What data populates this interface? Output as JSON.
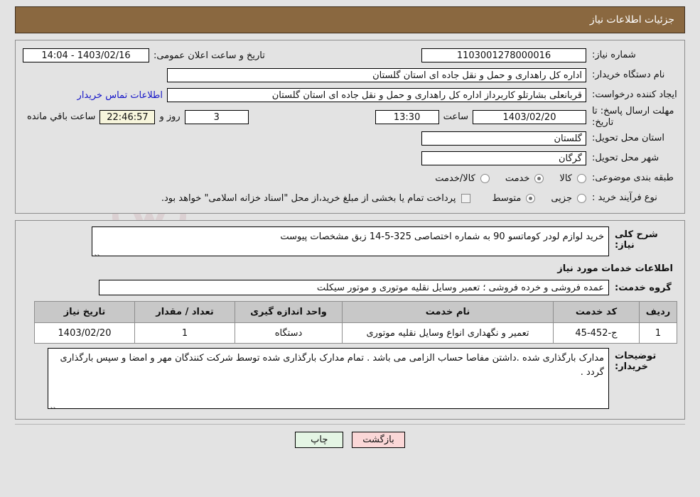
{
  "header": {
    "title": "جزئیات اطلاعات نیاز"
  },
  "watermark": {
    "text": "AriaTender.net",
    "shield_icon": "shield-icon"
  },
  "info": {
    "need_number_label": "شماره نیاز:",
    "need_number_value": "1103001278000016",
    "public_announce_label": "تاریخ و ساعت اعلان عمومی:",
    "public_announce_value": "1403/02/16 - 14:04",
    "buyer_org_label": "نام دستگاه خریدار:",
    "buyer_org_value": "اداره کل راهداری و حمل و نقل جاده ای استان گلستان",
    "creator_label": "ایجاد کننده درخواست:",
    "creator_value": "قربانعلی بشارتلو کاربرداز اداره کل راهداری و حمل و نقل جاده ای استان گلستان",
    "contact_link": "اطلاعات تماس خریدار",
    "deadline_label": "مهلت ارسال پاسخ: تا تاریخ:",
    "deadline_date": "1403/02/20",
    "deadline_hour_label": "ساعت",
    "deadline_time": "13:30",
    "remaining_days": "3",
    "remaining_days_label": "روز و",
    "remaining_clock": "22:46:57",
    "remaining_suffix_label": "ساعت باقي مانده",
    "province_label": "استان محل تحویل:",
    "province_value": "گلستان",
    "city_label": "شهر محل تحویل:",
    "city_value": "گرگان",
    "category_label": "طبقه بندی موضوعی:",
    "category_options": [
      {
        "label": "کالا",
        "selected": false
      },
      {
        "label": "خدمت",
        "selected": true
      },
      {
        "label": "کالا/خدمت",
        "selected": false
      }
    ],
    "process_label": "نوع فرآیند خرید :",
    "process_options": [
      {
        "label": "جزیی",
        "selected": false
      },
      {
        "label": "متوسط",
        "selected": true
      }
    ],
    "treasury_checkbox_label": "پرداخت تمام یا بخشی از مبلغ خرید،از محل \"اسناد خزانه اسلامی\" خواهد بود.",
    "treasury_checked": false
  },
  "details": {
    "need_desc_label": "شرح کلی نیاز:",
    "need_desc_value": "خرید لوازم لودر کوماتسو 90 به شماره اختصاصی 325-5-14 زبق مشخصات پیوست",
    "services_section_title": "اطلاعات خدمات مورد نیاز",
    "service_group_label": "گروه خدمت:",
    "service_group_value": "عمده فروشی و خرده فروشی ؛ تعمیر وسایل نقلیه موتوری و موتور سیکلت",
    "table": {
      "columns": [
        "ردیف",
        "کد خدمت",
        "نام خدمت",
        "واحد اندازه گیری",
        "تعداد / مقدار",
        "تاریخ نیاز"
      ],
      "rows": [
        {
          "row": "1",
          "code": "ج-452-45",
          "name": "تعمیر و نگهداری انواع وسایل نقلیه موتوری",
          "unit": "دستگاه",
          "qty": "1",
          "date": "1403/02/20"
        }
      ]
    },
    "buyer_notes_label": "توضیحات خریدار:",
    "buyer_notes_value": "مدارک بارگذاری شده .داشتن مفاصا حساب الزامی می باشد . تمام مدارک بارگذاری شده توسط شرکت کنندگان مهر و امضا و سپس بارگذاری گردد ."
  },
  "footer": {
    "print_label": "چاپ",
    "back_label": "بازگشت"
  },
  "colors": {
    "header_bg": "#8a6840",
    "page_bg": "#e3e3e3",
    "link": "#1414c8",
    "highlight_field": "#f7f5dc",
    "table_header": "#c8c8c8",
    "btn_print": "#e4f5e4",
    "btn_back": "#fbd7d7"
  }
}
